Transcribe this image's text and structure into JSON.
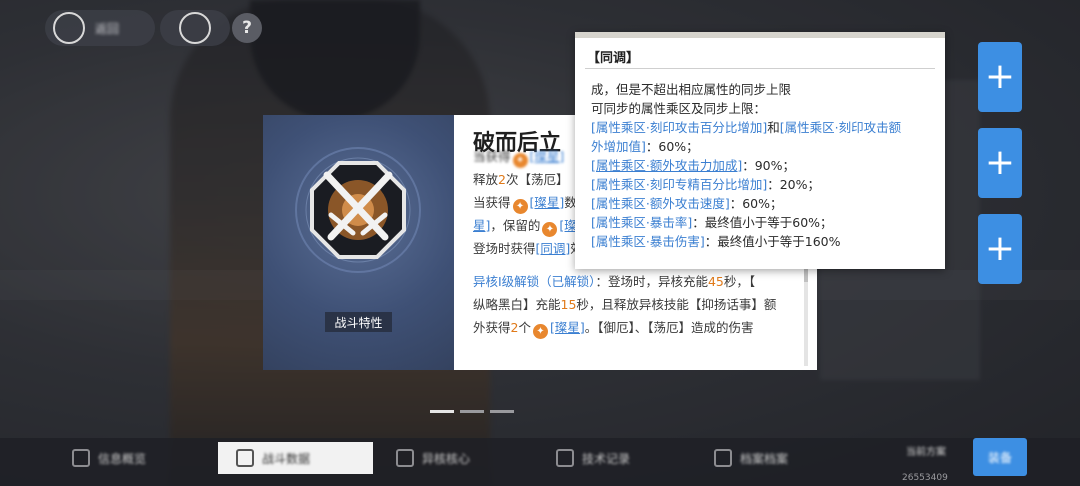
{
  "header": {
    "back_label": "返回"
  },
  "skill_card": {
    "category": "战斗特性",
    "title": "破而后立",
    "lines": {
      "l1": "当获得",
      "l1_link": "[璨星]",
      "l2_a": "释放",
      "l2_num": "2",
      "l2_b": "次【荡厄】",
      "l3_a": "当获得",
      "l3_link": "[璨星]",
      "l3_b": "数",
      "l4_a": "星]",
      "l4_b": "，保留的",
      "l4_link": "[璨",
      "l5_a": "登场时获得",
      "l5_link": "[同调]",
      "l5_b": "效果",
      "core_label": "异核Ⅰ级解锁（已解锁）",
      "core_a": "：登场时，异核充能",
      "core_num1": "45",
      "core_b": "秒，【",
      "l7_a": "纵略黑白】充能",
      "l7_num": "15",
      "l7_b": "秒，且释放异核技能【抑扬话事】额",
      "l8_a": "外获得",
      "l8_num": "2",
      "l8_b": "个",
      "l8_link": "[璨星]",
      "l8_c": "。【御厄】、【荡厄】造成的伤害"
    }
  },
  "tooltip": {
    "header": "【同调】",
    "line1": "成，但是不超出相应属性的同步上限",
    "line2": "可同步的属性乘区及同步上限：",
    "r1_a": "[属性乘区·刻印攻击百分比增加]",
    "r1_b": "和",
    "r1_c": "[属性乘区·刻印攻击额",
    "r2_a": "外增加值]",
    "r2_b": "：60%；",
    "r3_a": "[属性乘区·额外攻击力加成]",
    "r3_b": "：90%；",
    "r4_a": "[属性乘区·刻印专精百分比增加]",
    "r4_b": "：20%；",
    "r5_a": "[属性乘区·额外攻击速度]",
    "r5_b": "：60%；",
    "r6_a": "[属性乘区·暴击率]",
    "r6_b": "：最终值小于等于60%；",
    "r7_a": "[属性乘区·暴击伤害]",
    "r7_b": "：最终值小于等于160%"
  },
  "bottom_nav": {
    "items": [
      "信息概览",
      "战斗数据",
      "异核核心",
      "技术记录",
      "档案档案"
    ],
    "active_index": 1,
    "side_text": "当前方案",
    "confirm_label": "装备",
    "uid": "26553409"
  },
  "colors": {
    "accent_blue": "#3d8fe3",
    "link_blue": "#3b7fd1",
    "star_orange": "#e8872e"
  },
  "icons": {
    "star_glyph": "✦",
    "plus_glyph": "+",
    "help_glyph": "?"
  }
}
